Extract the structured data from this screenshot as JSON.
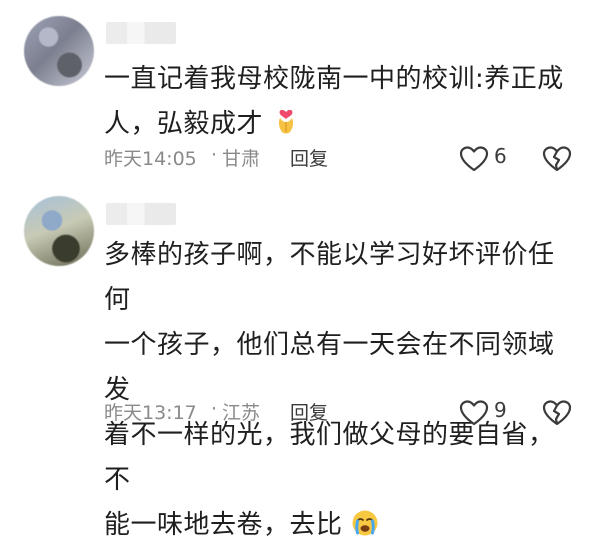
{
  "comments": [
    {
      "text_lines": [
        "一直记着我母校陇南一中的校训:养正成",
        "人，弘毅成才"
      ],
      "emoji": "heart-hands-emoji",
      "time": "昨天14:05",
      "separator": "·",
      "location": "甘肃",
      "reply_label": "回复",
      "likes": "6"
    },
    {
      "text_lines": [
        "多棒的孩子啊，不能以学习好坏评价任何",
        "一个孩子，他们总有一天会在不同领域发",
        "着不一样的光，我们做父母的要自省，不",
        "能一味地去卷，去比"
      ],
      "emoji": "crying-face-emoji",
      "time": "昨天13:17",
      "separator": "·",
      "location": "江苏",
      "reply_label": "回复",
      "likes": "9"
    }
  ],
  "colors": {
    "text": "#1f1f1f",
    "meta": "#8a8a8a",
    "icon": "#3b3b3b"
  },
  "icons": [
    "heart-outline-icon",
    "broken-heart-icon"
  ]
}
